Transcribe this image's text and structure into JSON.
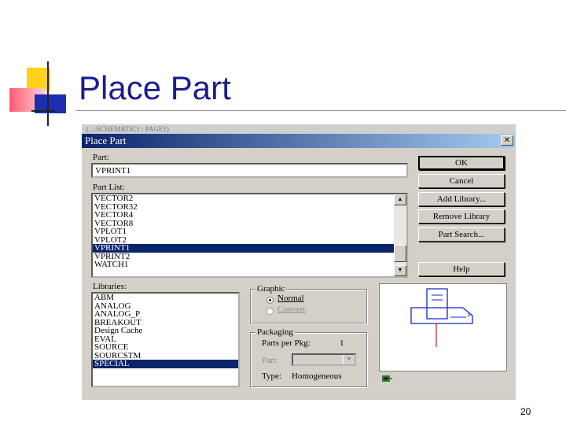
{
  "slide": {
    "title": "Place Part",
    "page_number": "20"
  },
  "background_window": {
    "title": "(...:SCHEMATIC1 : PAGE1)"
  },
  "dialog": {
    "title": "Place Part",
    "close_glyph": "✕",
    "part_label": "Part:",
    "part_value": "VPRINT1",
    "part_list_label": "Part List:",
    "part_list": [
      "VECTOR2",
      "VECTOR32",
      "VECTOR4",
      "VECTOR8",
      "VPLOT1",
      "VPLOT2",
      "VPRINT1",
      "VPRINT2",
      "WATCH1"
    ],
    "part_list_selected": "VPRINT1",
    "libraries_label": "Libraries:",
    "libraries": [
      "ABM",
      "ANALOG",
      "ANALOG_P",
      "BREAKOUT",
      "Design Cache",
      "EVAL",
      "SOURCE",
      "SOURCSTM",
      "SPECIAL"
    ],
    "libraries_selected": "SPECIAL",
    "buttons": {
      "ok": "OK",
      "cancel": "Cancel",
      "add_library": "Add Library...",
      "remove_library": "Remove Library",
      "part_search": "Part Search...",
      "help": "Help"
    },
    "graphic": {
      "title": "Graphic",
      "normal": "Normal",
      "convert": "Convert",
      "selected": "Normal"
    },
    "packaging": {
      "title": "Packaging",
      "parts_per_pkg_label": "Parts per Pkg:",
      "parts_per_pkg_value": "1",
      "part_label": "Part:",
      "type_label": "Type:",
      "type_value": "Homogeneous"
    }
  },
  "colors": {
    "title_bar": "#0a246a",
    "slide_title": "#1a1e90",
    "preview_symbol": "#1428c8",
    "preview_pin": "#c82828"
  },
  "icons": {
    "scroll_up": "▲",
    "scroll_down": "▼",
    "combo_down": "▼"
  }
}
